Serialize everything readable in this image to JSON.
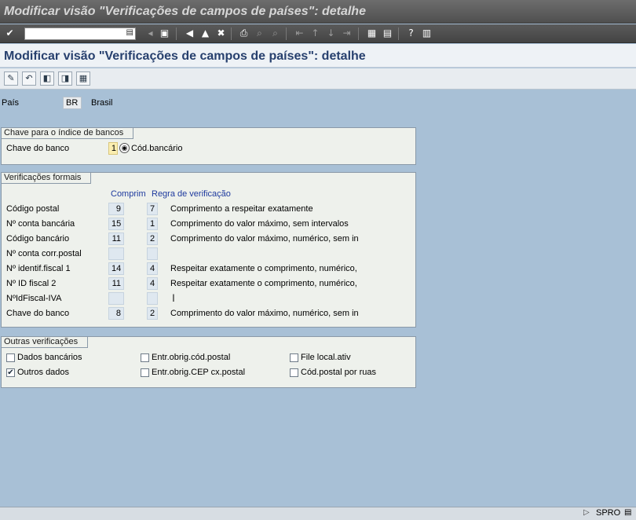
{
  "window": {
    "title": "Modificar visão \"Verificações de campos de países\": detalhe"
  },
  "system_toolbar": {
    "command_field": "",
    "icons": [
      "enter-icon",
      "back-icon",
      "save-icon",
      "back-arrow-icon",
      "exit-icon",
      "cancel-icon",
      "print-icon",
      "find-icon",
      "find-next-icon",
      "first-page-icon",
      "prev-page-icon",
      "next-page-icon",
      "last-page-icon",
      "new-session-icon",
      "shortcut-icon",
      "help-icon",
      "customize-icon"
    ]
  },
  "app_title": "Modificar visão \"Verificações de campos de países\": detalhe",
  "app_toolbar": {
    "icons": [
      "change-display-icon",
      "undo-icon",
      "prev-entry-icon",
      "next-entry-icon",
      "variable-list-icon"
    ]
  },
  "header": {
    "country_label": "País",
    "country_code": "BR",
    "country_name": "Brasil"
  },
  "bank_key_group": {
    "title": "Chave para o índice de bancos",
    "label": "Chave do banco",
    "value": "1",
    "value_text": "Cód.bancário"
  },
  "formal_checks": {
    "title": "Verificações formais",
    "col_length": "Comprim",
    "col_rule": "Regra de verificação",
    "rows": [
      {
        "label": "Código postal",
        "length": "9",
        "rule": "7",
        "rule_text": "Comprimento a respeitar exatamente"
      },
      {
        "label": "Nº conta bancária",
        "length": "15",
        "rule": "1",
        "rule_text": "Comprimento do valor máximo, sem intervalos"
      },
      {
        "label": "Código bancário",
        "length": "11",
        "rule": "2",
        "rule_text": "Comprimento do valor máximo, numérico, sem in"
      },
      {
        "label": "Nº conta corr.postal",
        "length": "",
        "rule": "",
        "rule_text": ""
      },
      {
        "label": "Nº identif.fiscal 1",
        "length": "14",
        "rule": "4",
        "rule_text": "Respeitar exatamente o comprimento, numérico,"
      },
      {
        "label": "Nº ID fiscal 2",
        "length": "11",
        "rule": "4",
        "rule_text": "Respeitar exatamente o comprimento, numérico,"
      },
      {
        "label": "NºIdFiscal-IVA",
        "length": "",
        "rule": "",
        "rule_text": ""
      },
      {
        "label": "Chave do banco",
        "length": "8",
        "rule": "2",
        "rule_text": "Comprimento do valor máximo, numérico, sem in"
      }
    ]
  },
  "other_checks": {
    "title": "Outras verificações",
    "items": [
      {
        "label": "Dados bancários",
        "checked": false
      },
      {
        "label": "Entr.obrig.cód.postal",
        "checked": false
      },
      {
        "label": "File local.ativ",
        "checked": false
      },
      {
        "label": "Outros dados",
        "checked": true
      },
      {
        "label": "Entr.obrig.CEP cx.postal",
        "checked": false
      },
      {
        "label": "Cód.postal por ruas",
        "checked": false
      }
    ]
  },
  "status_bar": {
    "system": "SPRO"
  }
}
